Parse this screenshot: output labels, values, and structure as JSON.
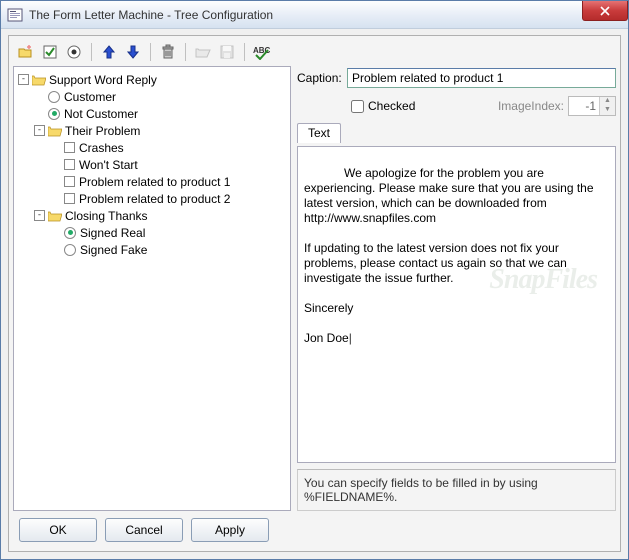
{
  "window": {
    "title": "The Form Letter Machine - Tree Configuration"
  },
  "dialogButtons": {
    "ok": "OK",
    "cancel": "Cancel",
    "apply": "Apply"
  },
  "tree": {
    "root": {
      "label": "Support Word Reply",
      "children": {
        "customer": "Customer",
        "notCustomer": "Not Customer",
        "theirProblem": {
          "label": "Their Problem",
          "children": {
            "crashes": "Crashes",
            "wontStart": "Won't Start",
            "prod1": "Problem related to product 1",
            "prod2": "Problem related to product 2"
          }
        },
        "closingThanks": {
          "label": "Closing Thanks",
          "children": {
            "signedReal": "Signed Real",
            "signedFake": "Signed Fake"
          }
        }
      }
    }
  },
  "detail": {
    "captionLabel": "Caption:",
    "captionValue": "Problem related to product 1",
    "checkedLabel": "Checked",
    "checkedValue": false,
    "imageIndexLabel": "ImageIndex:",
    "imageIndexValue": "-1",
    "tabText": "Text",
    "bodyText": "We apologize for the problem you are experiencing. Please make sure that you are using the latest version, which can be downloaded from http://www.snapfiles.com\n\nIf updating to the latest version does not fix your problems, please contact us again so that we can  investigate the issue further.\n\nSincerely\n\nJon Doe",
    "hint": "You can specify fields to be filled in by using %FIELDNAME%."
  },
  "watermark": "SnapFiles"
}
